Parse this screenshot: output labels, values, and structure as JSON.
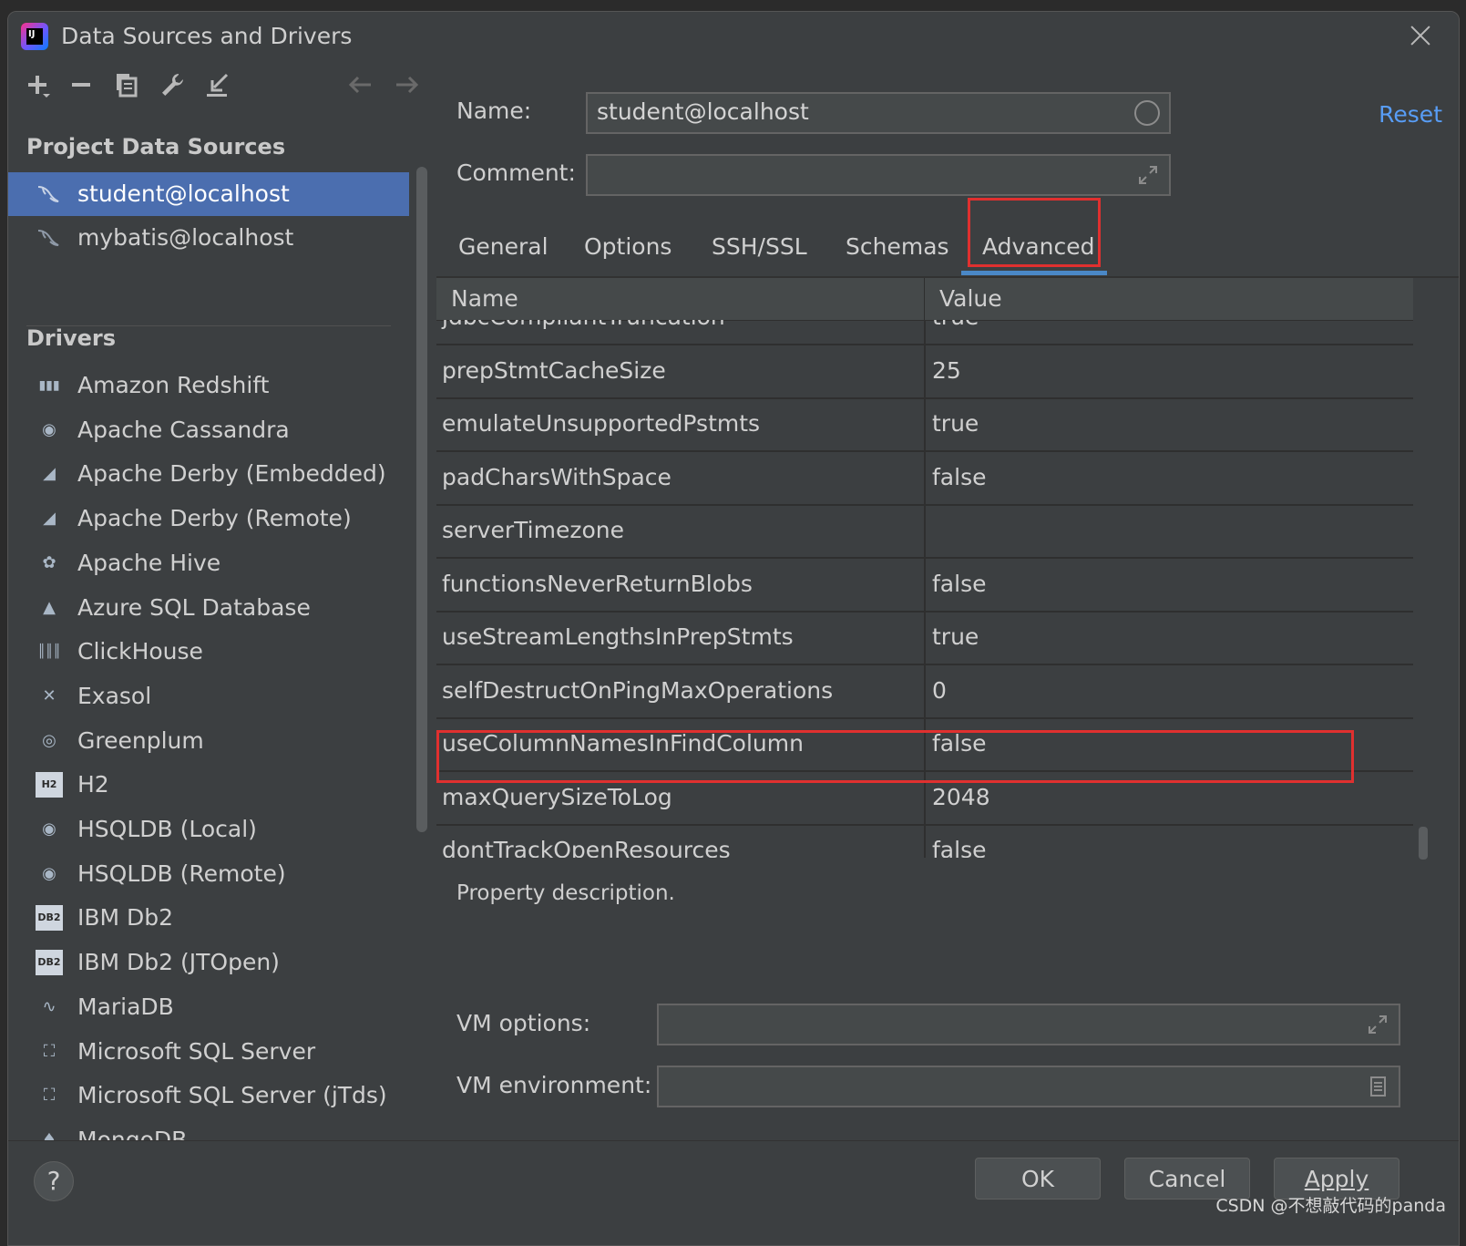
{
  "window": {
    "title": "Data Sources and Drivers",
    "app_icon_text": "IJ"
  },
  "sidebar": {
    "project_header": "Project Data Sources",
    "data_sources": [
      {
        "label": "student@localhost",
        "selected": true
      },
      {
        "label": "mybatis@localhost",
        "selected": false
      }
    ],
    "drivers_header": "Drivers",
    "drivers": [
      {
        "label": "Amazon Redshift",
        "icon": "redshift-icon"
      },
      {
        "label": "Apache Cassandra",
        "icon": "cassandra-icon"
      },
      {
        "label": "Apache Derby (Embedded)",
        "icon": "derby-icon"
      },
      {
        "label": "Apache Derby (Remote)",
        "icon": "derby-icon"
      },
      {
        "label": "Apache Hive",
        "icon": "hive-icon"
      },
      {
        "label": "Azure SQL Database",
        "icon": "azure-icon"
      },
      {
        "label": "ClickHouse",
        "icon": "clickhouse-icon"
      },
      {
        "label": "Exasol",
        "icon": "exasol-icon"
      },
      {
        "label": "Greenplum",
        "icon": "greenplum-icon"
      },
      {
        "label": "H2",
        "icon": "h2-icon"
      },
      {
        "label": "HSQLDB (Local)",
        "icon": "hsqldb-icon"
      },
      {
        "label": "HSQLDB (Remote)",
        "icon": "hsqldb-icon"
      },
      {
        "label": "IBM Db2",
        "icon": "db2-icon"
      },
      {
        "label": "IBM Db2 (JTOpen)",
        "icon": "db2-icon"
      },
      {
        "label": "MariaDB",
        "icon": "mariadb-icon"
      },
      {
        "label": "Microsoft SQL Server",
        "icon": "mssql-icon"
      },
      {
        "label": "Microsoft SQL Server (jTds)",
        "icon": "mssql-icon"
      },
      {
        "label": "MongoDB",
        "icon": "mongodb-icon"
      }
    ]
  },
  "form": {
    "name_label": "Name:",
    "name_value": "student@localhost",
    "comment_label": "Comment:",
    "comment_value": "",
    "reset_label": "Reset"
  },
  "tabs": [
    "General",
    "Options",
    "SSH/SSL",
    "Schemas",
    "Advanced"
  ],
  "active_tab": "Advanced",
  "table": {
    "col_name": "Name",
    "col_value": "Value",
    "rows": [
      {
        "name": "jdbcCompliantTruncation",
        "value": "true"
      },
      {
        "name": "prepStmtCacheSize",
        "value": "25"
      },
      {
        "name": "emulateUnsupportedPstmts",
        "value": "true"
      },
      {
        "name": "padCharsWithSpace",
        "value": "false"
      },
      {
        "name": "serverTimezone",
        "value": ""
      },
      {
        "name": "functionsNeverReturnBlobs",
        "value": "false"
      },
      {
        "name": "useStreamLengthsInPrepStmts",
        "value": "true"
      },
      {
        "name": "selfDestructOnPingMaxOperations",
        "value": "0"
      },
      {
        "name": "useColumnNamesInFindColumn",
        "value": "false"
      },
      {
        "name": "maxQuerySizeToLog",
        "value": "2048"
      },
      {
        "name": "dontTrackOpenResources",
        "value": "false"
      }
    ]
  },
  "description": "Property description.",
  "vm": {
    "options_label": "VM options:",
    "options_value": "",
    "environment_label": "VM environment:",
    "environment_value": ""
  },
  "footer": {
    "help_label": "?",
    "ok_label": "OK",
    "cancel_label": "Cancel",
    "apply_label": "Apply",
    "watermark": "CSDN @不想敲代码的panda"
  },
  "colors": {
    "selection": "#4b6eaf",
    "link": "#589df6",
    "highlight_box": "#e0302f",
    "tab_underline": "#4a88c7"
  }
}
